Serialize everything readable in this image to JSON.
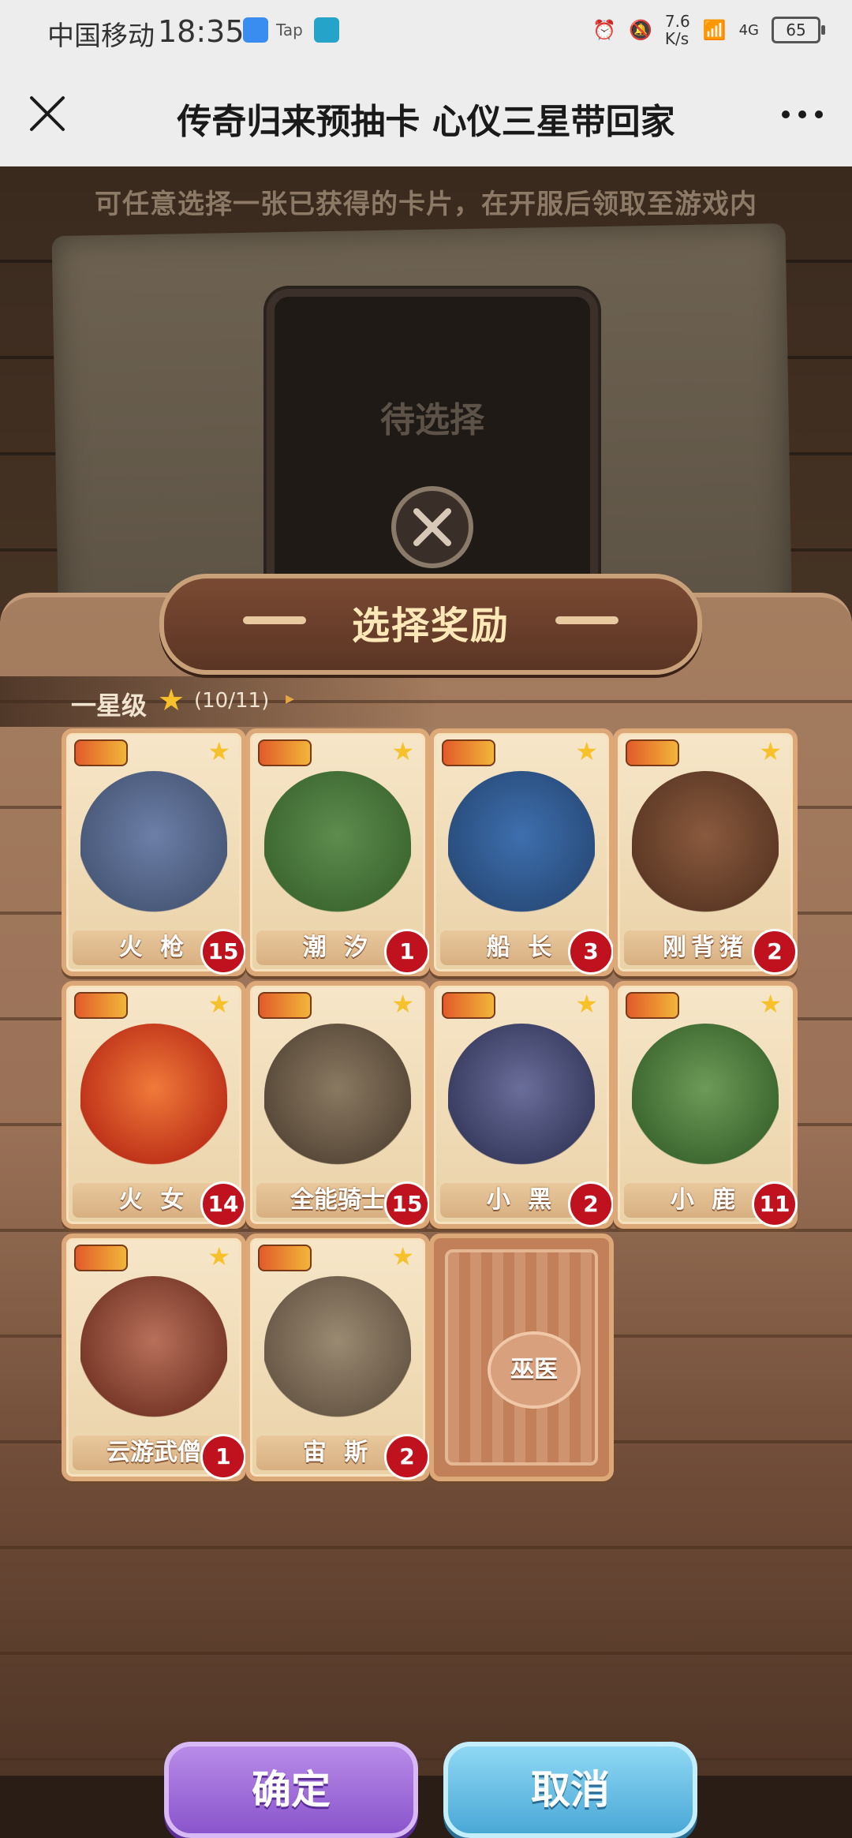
{
  "status_bar": {
    "carrier": "中国移动",
    "time": "18:35",
    "tap_label": "Tap",
    "net_speed": "7.6\nK/s",
    "net_type": "4G",
    "battery": "65"
  },
  "nav": {
    "title": "传奇归来预抽卡 心仪三星带回家",
    "close_icon": "close-icon",
    "more_icon": "more-icon"
  },
  "stage": {
    "hint": "可任意选择一张已获得的卡片，在开服后领取至游戏内",
    "pending_label": "待选择"
  },
  "panel": {
    "title": "选择奖励",
    "tier": {
      "name": "一星级",
      "count": "(10/11)"
    }
  },
  "cards": [
    {
      "name": "火 枪",
      "count": "15",
      "art_color": "#6d7fa8"
    },
    {
      "name": "潮 汐",
      "count": "1",
      "art_color": "#5e8c4e"
    },
    {
      "name": "船 长",
      "count": "3",
      "art_color": "#3e6fae"
    },
    {
      "name": "刚背猪",
      "count": "2",
      "art_color": "#8a5a3e"
    },
    {
      "name": "火 女",
      "count": "14",
      "art_color": "#e0542a"
    },
    {
      "name": "全能骑士",
      "count": "15",
      "art_color": "#7a6a58"
    },
    {
      "name": "小 黑",
      "count": "2",
      "art_color": "#5a5e8a"
    },
    {
      "name": "小 鹿",
      "count": "11",
      "art_color": "#5e8a4a"
    },
    {
      "name": "云游武僧",
      "count": "1",
      "art_color": "#a8584a"
    },
    {
      "name": "宙 斯",
      "count": "2",
      "art_color": "#8a7a6a"
    }
  ],
  "locked_card": {
    "name": "巫医"
  },
  "buttons": {
    "confirm": "确定",
    "cancel": "取消"
  },
  "colors": {
    "badge": "#c0121e",
    "confirm": "#8a55cc",
    "cancel": "#4aa8d6",
    "star": "#f6c12a"
  }
}
